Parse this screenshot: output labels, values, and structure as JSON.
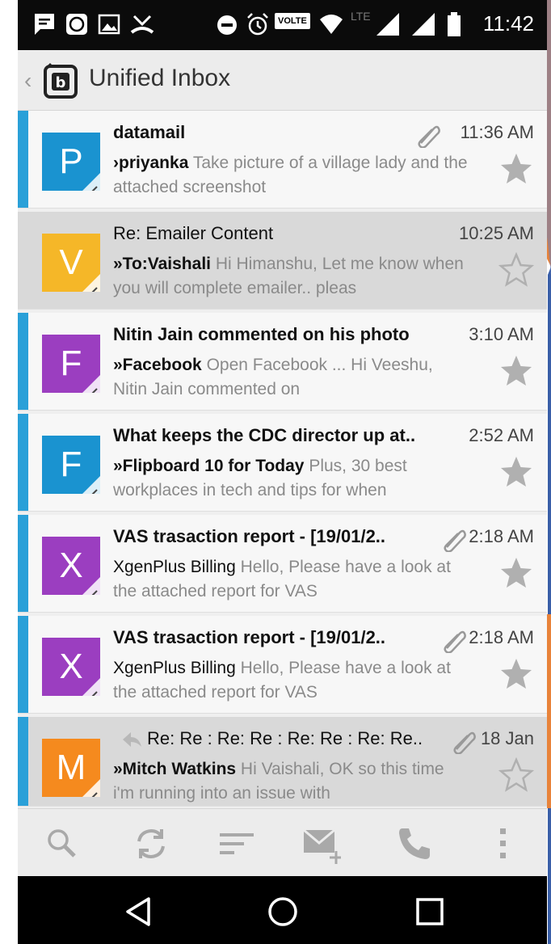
{
  "status_bar": {
    "time": "11:42",
    "icons": [
      "message-icon",
      "whatsapp-icon",
      "image-icon",
      "missed-call-icon",
      "do-not-disturb-icon",
      "alarm-icon",
      "volte-icon",
      "wifi-icon",
      "lte-icon",
      "signal-icon",
      "signal-icon",
      "battery-icon"
    ],
    "volte_label": "VOLTE",
    "lte_label": "LTE"
  },
  "app_bar": {
    "title": "Unified Inbox",
    "back_icon": "chevron-left-icon",
    "logo_icon": "inbox-logo-icon"
  },
  "emails": [
    {
      "avatar_letter": "P",
      "avatar_color": "#1a93d0",
      "subject": "datamail",
      "subject_bold": true,
      "time": "11:36 AM",
      "has_attachment": true,
      "sender": "›priyanka",
      "sender_bold": true,
      "preview": "Take picture of a village lady and the attached screenshot",
      "unread": true
    },
    {
      "avatar_letter": "V",
      "avatar_color": "#f5b728",
      "subject": "Re: Emailer Content",
      "subject_bold": false,
      "time": "10:25 AM",
      "has_attachment": false,
      "sender": "»To:Vaishali",
      "sender_bold": true,
      "preview": "Hi Himanshu, Let me know when you will complete emailer.. pleas",
      "unread": false,
      "selected": true
    },
    {
      "avatar_letter": "F",
      "avatar_color": "#9b3ec0",
      "subject": "Nitin Jain commented on his photo",
      "subject_bold": true,
      "time": "3:10 AM",
      "has_attachment": false,
      "sender": "»Facebook",
      "sender_bold": true,
      "preview": "Open Facebook ... Hi Veeshu, Nitin Jain commented on",
      "unread": true
    },
    {
      "avatar_letter": "F",
      "avatar_color": "#1a93d0",
      "subject": "What keeps the CDC director up at..",
      "subject_bold": true,
      "time": "2:52 AM",
      "has_attachment": false,
      "sender": "»Flipboard 10 for Today",
      "sender_bold": true,
      "preview": "Plus, 30 best workplaces in tech and tips for when",
      "unread": true
    },
    {
      "avatar_letter": "X",
      "avatar_color": "#9b3ec0",
      "subject": "VAS trasaction report - [19/01/2..",
      "subject_bold": true,
      "time": "2:18 AM",
      "has_attachment": true,
      "sender": "XgenPlus Billing",
      "sender_bold": false,
      "preview": "Hello, Please have a look at the attached report for VAS",
      "unread": true
    },
    {
      "avatar_letter": "X",
      "avatar_color": "#9b3ec0",
      "subject": "VAS trasaction report - [19/01/2..",
      "subject_bold": true,
      "time": "2:18 AM",
      "has_attachment": true,
      "sender": "XgenPlus Billing",
      "sender_bold": false,
      "preview": "Hello, Please have a look at the attached report for VAS",
      "unread": true
    },
    {
      "avatar_letter": "M",
      "avatar_color": "#f58a1e",
      "subject": "Re: Re : Re: Re : Re: Re : Re: Re..",
      "subject_bold": false,
      "time": "18 Jan",
      "has_attachment": true,
      "is_reply": true,
      "sender": "»Mitch Watkins",
      "sender_bold": true,
      "preview": "Hi Vaishali, OK so this time i'm running into an issue with",
      "unread": true,
      "selected": true
    }
  ],
  "bottom_toolbar": [
    "search-icon",
    "refresh-icon",
    "sort-icon",
    "compose-icon",
    "call-icon",
    "more-icon"
  ],
  "nav_bar": [
    "back-icon",
    "home-icon",
    "recents-icon"
  ],
  "colors": {
    "accent": "#2aa0d8",
    "background": "#efefef",
    "selected_row": "#d9d9d9"
  }
}
